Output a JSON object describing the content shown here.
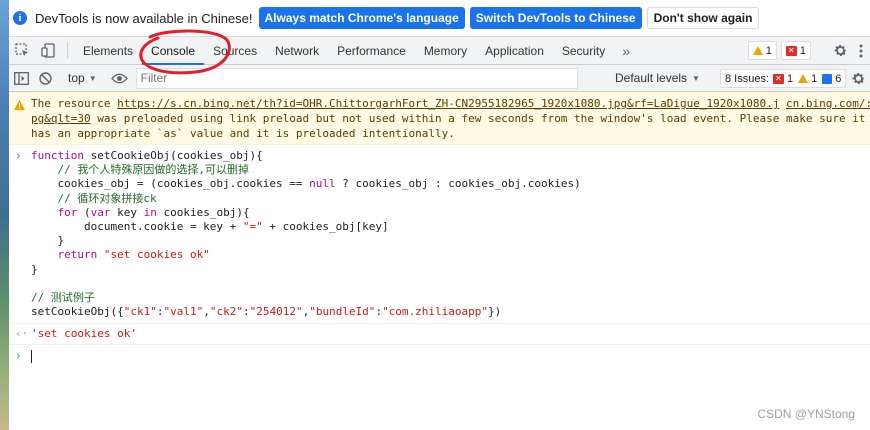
{
  "infobar": {
    "message": "DevTools is now available in Chinese!",
    "match_language_button": "Always match Chrome's language",
    "switch_button": "Switch DevTools to Chinese",
    "dont_show_button": "Don't show again"
  },
  "tabs": [
    {
      "label": "Elements"
    },
    {
      "label": "Console"
    },
    {
      "label": "Sources"
    },
    {
      "label": "Network"
    },
    {
      "label": "Performance"
    },
    {
      "label": "Memory"
    },
    {
      "label": "Application"
    },
    {
      "label": "Security"
    }
  ],
  "more_tabs": "»",
  "header_badges": {
    "warnings": "1",
    "errors": "1"
  },
  "console_toolbar": {
    "context": "top",
    "filter_placeholder": "Filter",
    "levels": "Default levels",
    "issues_label": "8 Issues:",
    "issues_errors": "1",
    "issues_warnings": "1",
    "issues_info": "6"
  },
  "warning": {
    "text_before": "The resource ",
    "url": "https://s.cn.bing.net/th?id=OHR.ChittorgarhFort_ZH-CN2955182965_1920x1080.jpg&rf=LaDigue_1920x1080.j",
    "url_cont": "pg&qlt=30",
    "source": "cn.bing.com/:",
    "line1_rest": " was preloaded using link preload but not used within a few seconds from the window's load event. Please make sure it",
    "line2": "has an appropriate `as` value and it is preloaded intentionally."
  },
  "code": {
    "l1a": "function",
    "l1b": " setCookieObj(cookies_obj){",
    "l2": "    // 我个人特殊原因做的选择,可以删掉",
    "l3a": "    cookies_obj = (cookies_obj.cookies == ",
    "l3b": "null",
    "l3c": " ? cookies_obj : cookies_obj.cookies)",
    "l4": "    // 循环对象拼接ck",
    "l5a": "    for",
    "l5b": " (",
    "l5c": "var",
    "l5d": " key ",
    "l5e": "in",
    "l5f": " cookies_obj){",
    "l6a": "        document.cookie = key + ",
    "l6b": "\"=\"",
    "l6c": " + cookies_obj[key]",
    "l7": "    }",
    "l8a": "    return",
    "l8b": " ",
    "l8c": "\"set cookies ok\"",
    "l9": "}",
    "l10": "",
    "l11": "// 测试例子",
    "l12a": "setCookieObj({",
    "l12b": "\"ck1\"",
    "l12c": ":",
    "l12d": "\"val1\"",
    "l12e": ",",
    "l12f": "\"ck2\"",
    "l12g": ":",
    "l12h": "\"254012\"",
    "l12i": ",",
    "l12j": "\"bundleId\"",
    "l12k": ":",
    "l12l": "\"com.zhiliaoapp\"",
    "l12m": "})"
  },
  "result": "'set cookies ok'",
  "watermark": "CSDN @YNStong",
  "colors": {
    "accent": "#1a73e8",
    "warning_bg": "#fffbe5",
    "annotation": "#e0202a"
  }
}
